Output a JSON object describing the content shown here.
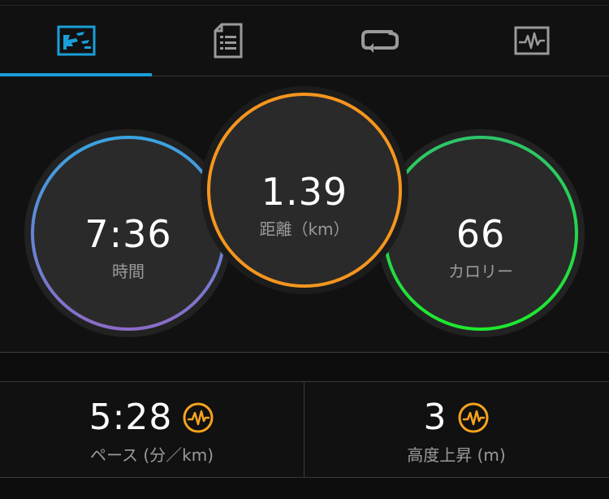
{
  "tabs": [
    {
      "name": "overview",
      "icon": "running-shoe-chart-icon",
      "active": true
    },
    {
      "name": "details",
      "icon": "document-list-icon",
      "active": false
    },
    {
      "name": "laps",
      "icon": "loop-arrows-icon",
      "active": false
    },
    {
      "name": "charts",
      "icon": "heart-rate-monitor-icon",
      "active": false
    }
  ],
  "rings": {
    "time": {
      "value": "7:36",
      "label": "時間"
    },
    "distance": {
      "value": "1.39",
      "label": "距離（km）"
    },
    "calories": {
      "value": "66",
      "label": "カロリー"
    }
  },
  "stats": {
    "pace": {
      "value": "5:28",
      "label": "ペース (分／km)",
      "icon": "activity-wave-icon"
    },
    "elevation": {
      "value": "3",
      "label": "高度上昇 (m)",
      "icon": "activity-wave-icon"
    }
  },
  "colors": {
    "accent": "#1a9fd8",
    "time_ring_top": "#3aa3e0",
    "time_ring_bottom": "#8b6cc8",
    "distance_ring": "#f5961e",
    "calories_ring_top": "#2ec46a",
    "calories_ring_bottom": "#1ee82e",
    "stat_icon": "#f5a31e"
  }
}
